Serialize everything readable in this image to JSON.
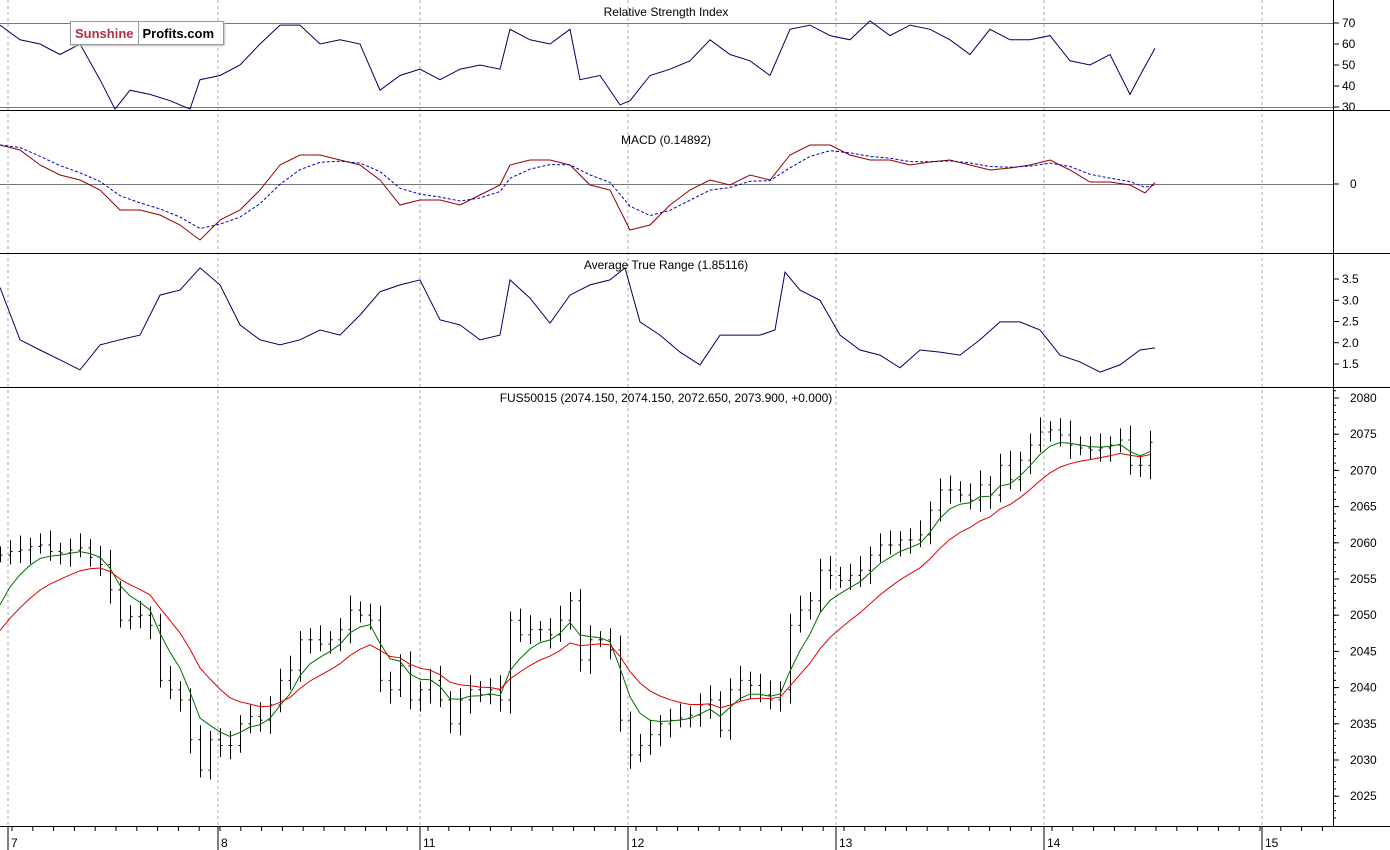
{
  "logo": {
    "part1": "Sunshine",
    "part2": "Profits.com"
  },
  "colors": {
    "price": "#000000",
    "ma_fast": "#007000",
    "ma_slow": "#e00000",
    "rsi": "#000060",
    "macd": "#900000",
    "signal": "#0000c0",
    "atr": "#000060",
    "grid": "#aaaaaa"
  },
  "chart_data": [
    {
      "type": "line",
      "title": "Relative Strength Index",
      "ylim": [
        15,
        85
      ],
      "ticks": [
        30,
        40,
        50,
        60,
        70
      ],
      "reference_lines": [
        30,
        70
      ],
      "points": [
        [
          0,
          69
        ],
        [
          2,
          62
        ],
        [
          4,
          60
        ],
        [
          6,
          55
        ],
        [
          8,
          60
        ],
        [
          10,
          43
        ],
        [
          11.5,
          29
        ],
        [
          13,
          38
        ],
        [
          15,
          36
        ],
        [
          17,
          33
        ],
        [
          19,
          29
        ],
        [
          20,
          43
        ],
        [
          22,
          45
        ],
        [
          24,
          50
        ],
        [
          26,
          60
        ],
        [
          28,
          69
        ],
        [
          30,
          69
        ],
        [
          32,
          60
        ],
        [
          34,
          62
        ],
        [
          36,
          60
        ],
        [
          38,
          38
        ],
        [
          40,
          45
        ],
        [
          42,
          48
        ],
        [
          44,
          43
        ],
        [
          46,
          48
        ],
        [
          48,
          50
        ],
        [
          50,
          48
        ],
        [
          51,
          67
        ],
        [
          53,
          62
        ],
        [
          55,
          60
        ],
        [
          57,
          67
        ],
        [
          58,
          43
        ],
        [
          60,
          45
        ],
        [
          62,
          31
        ],
        [
          63,
          33
        ],
        [
          65,
          45
        ],
        [
          67,
          48
        ],
        [
          69,
          52
        ],
        [
          71,
          62
        ],
        [
          73,
          55
        ],
        [
          75,
          52
        ],
        [
          77,
          45
        ],
        [
          79,
          67
        ],
        [
          81,
          69
        ],
        [
          83,
          64
        ],
        [
          85,
          62
        ],
        [
          87,
          71
        ],
        [
          89,
          64
        ],
        [
          91,
          69
        ],
        [
          93,
          67
        ],
        [
          95,
          62
        ],
        [
          97,
          55
        ],
        [
          99,
          67
        ],
        [
          101,
          62
        ],
        [
          103,
          62
        ],
        [
          105,
          64
        ],
        [
          107,
          52
        ],
        [
          109,
          50
        ],
        [
          111,
          55
        ],
        [
          113,
          36
        ],
        [
          114,
          45
        ],
        [
          115.5,
          58
        ]
      ]
    },
    {
      "type": "line",
      "title": "MACD (0.14892)",
      "ylim": [
        -7,
        7.5
      ],
      "ticks": [
        0
      ],
      "reference_lines": [
        0
      ],
      "signal_period": 3,
      "points": [
        [
          0,
          3.9
        ],
        [
          2,
          3.4
        ],
        [
          4,
          1.9
        ],
        [
          6,
          0.9
        ],
        [
          8,
          0.4
        ],
        [
          10,
          -0.6
        ],
        [
          12,
          -2.6
        ],
        [
          14,
          -2.6
        ],
        [
          16,
          -3.1
        ],
        [
          18,
          -4.1
        ],
        [
          20,
          -5.6
        ],
        [
          22,
          -3.6
        ],
        [
          24,
          -2.6
        ],
        [
          26,
          -0.6
        ],
        [
          28,
          1.9
        ],
        [
          30,
          2.9
        ],
        [
          32,
          2.9
        ],
        [
          34,
          2.4
        ],
        [
          36,
          1.9
        ],
        [
          38,
          0.4
        ],
        [
          40,
          -2.1
        ],
        [
          42,
          -1.6
        ],
        [
          44,
          -1.6
        ],
        [
          46,
          -2.1
        ],
        [
          48,
          -1.1
        ],
        [
          50,
          -0.1
        ],
        [
          51,
          1.9
        ],
        [
          53,
          2.4
        ],
        [
          55,
          2.4
        ],
        [
          57,
          1.9
        ],
        [
          59,
          -0.1
        ],
        [
          61,
          -0.6
        ],
        [
          63,
          -4.6
        ],
        [
          65,
          -4.1
        ],
        [
          67,
          -2.1
        ],
        [
          69,
          -0.6
        ],
        [
          71,
          0.4
        ],
        [
          73,
          -0.1
        ],
        [
          75,
          0.9
        ],
        [
          77,
          0.4
        ],
        [
          79,
          2.9
        ],
        [
          81,
          3.9
        ],
        [
          83,
          3.9
        ],
        [
          85,
          2.9
        ],
        [
          87,
          2.4
        ],
        [
          89,
          2.4
        ],
        [
          91,
          1.9
        ],
        [
          93,
          2.2
        ],
        [
          95,
          2.4
        ],
        [
          97,
          1.9
        ],
        [
          99,
          1.4
        ],
        [
          101,
          1.6
        ],
        [
          103,
          1.9
        ],
        [
          105,
          2.4
        ],
        [
          107,
          1.4
        ],
        [
          109,
          0.2
        ],
        [
          111,
          0.2
        ],
        [
          113,
          -0.1
        ],
        [
          114.5,
          -0.9
        ],
        [
          115.5,
          0.15
        ]
      ]
    },
    {
      "type": "line",
      "title": "Average True Range (1.85116)",
      "ylim": [
        1.0,
        3.9
      ],
      "ticks": [
        1.5,
        2.0,
        2.5,
        3.0,
        3.5
      ],
      "points": [
        [
          0,
          3.3
        ],
        [
          2,
          2.07
        ],
        [
          4,
          1.83
        ],
        [
          6,
          1.6
        ],
        [
          8,
          1.36
        ],
        [
          10,
          1.95
        ],
        [
          12,
          2.07
        ],
        [
          14,
          2.18
        ],
        [
          16,
          3.12
        ],
        [
          18,
          3.24
        ],
        [
          20,
          3.76
        ],
        [
          22,
          3.36
        ],
        [
          24,
          2.42
        ],
        [
          26,
          2.07
        ],
        [
          28,
          1.95
        ],
        [
          30,
          2.07
        ],
        [
          32,
          2.3
        ],
        [
          34,
          2.18
        ],
        [
          36,
          2.65
        ],
        [
          38,
          3.2
        ],
        [
          40,
          3.36
        ],
        [
          42,
          3.48
        ],
        [
          44,
          2.54
        ],
        [
          46,
          2.42
        ],
        [
          48,
          2.07
        ],
        [
          50,
          2.18
        ],
        [
          51,
          3.48
        ],
        [
          53,
          3.05
        ],
        [
          55,
          2.46
        ],
        [
          57,
          3.12
        ],
        [
          59,
          3.36
        ],
        [
          61,
          3.48
        ],
        [
          62.5,
          3.76
        ],
        [
          64,
          2.49
        ],
        [
          66,
          2.18
        ],
        [
          68,
          1.78
        ],
        [
          70,
          1.48
        ],
        [
          72,
          2.18
        ],
        [
          74,
          2.18
        ],
        [
          76,
          2.18
        ],
        [
          77.5,
          2.3
        ],
        [
          78.5,
          3.66
        ],
        [
          80,
          3.24
        ],
        [
          82,
          3.0
        ],
        [
          84,
          2.18
        ],
        [
          86,
          1.83
        ],
        [
          88,
          1.71
        ],
        [
          90,
          1.41
        ],
        [
          92,
          1.83
        ],
        [
          94,
          1.78
        ],
        [
          96,
          1.71
        ],
        [
          98,
          2.07
        ],
        [
          100,
          2.49
        ],
        [
          102,
          2.49
        ],
        [
          104,
          2.3
        ],
        [
          106,
          1.71
        ],
        [
          108,
          1.55
        ],
        [
          110,
          1.31
        ],
        [
          112,
          1.48
        ],
        [
          114,
          1.83
        ],
        [
          115.5,
          1.88
        ]
      ]
    },
    {
      "type": "ohlc",
      "title": "FUS50015 (2074.150, 2074.150, 2072.650, 2073.900, +0.000)",
      "ylim": [
        2022,
        2082
      ],
      "ticks": [
        2025,
        2030,
        2035,
        2040,
        2045,
        2050,
        2055,
        2060,
        2065,
        2070,
        2075,
        2080
      ],
      "x_labels": [
        {
          "label": "7",
          "at": 1
        },
        {
          "label": "8",
          "at": 22
        },
        {
          "label": "11",
          "at": 42.2
        },
        {
          "label": "12",
          "at": 63
        },
        {
          "label": "13",
          "at": 83.8
        },
        {
          "label": "14",
          "at": 104.6
        },
        {
          "label": "15",
          "at": 126.4
        }
      ],
      "ma_fast": {
        "period": 5,
        "seed": 2048
      },
      "ma_slow": {
        "period": 12,
        "seed": 2046
      },
      "closes": [
        2058.3,
        2058.8,
        2059,
        2059.5,
        2059.7,
        2058.8,
        2058.6,
        2059,
        2059.3,
        2058,
        2057,
        2053.5,
        2049.3,
        2049.8,
        2050,
        2048.6,
        2041,
        2039.7,
        2038.3,
        2032.8,
        2028.6,
        2032.8,
        2032,
        2032,
        2035,
        2036,
        2035.5,
        2037.6,
        2041,
        2042.4,
        2046.6,
        2046.6,
        2046,
        2046.6,
        2048,
        2050.7,
        2050,
        2049.3,
        2041,
        2039.7,
        2043,
        2038.3,
        2039.7,
        2041,
        2038.3,
        2035,
        2038.3,
        2039.7,
        2039,
        2039.7,
        2038.3,
        2049.3,
        2047.3,
        2048,
        2048,
        2047.3,
        2049.3,
        2052,
        2043.8,
        2046.6,
        2046.6,
        2045.2,
        2035.5,
        2030.7,
        2032,
        2033.5,
        2035,
        2035.5,
        2035.8,
        2036.2,
        2037.6,
        2038.3,
        2034.1,
        2039.7,
        2041,
        2040.3,
        2039,
        2038.3,
        2039.7,
        2048.6,
        2050.7,
        2052,
        2056.2,
        2055.5,
        2054.8,
        2055.5,
        2056.2,
        2058.3,
        2059.7,
        2059.7,
        2060.4,
        2060.4,
        2061.1,
        2064.5,
        2067.3,
        2067.3,
        2066.6,
        2065.9,
        2068,
        2066.6,
        2070.7,
        2068.7,
        2071.4,
        2073.5,
        2075.3,
        2075.6,
        2074.9,
        2073.5,
        2073.1,
        2072.8,
        2073.1,
        2073.5,
        2074.2,
        2070.7,
        2070.7,
        2073.9
      ]
    }
  ]
}
